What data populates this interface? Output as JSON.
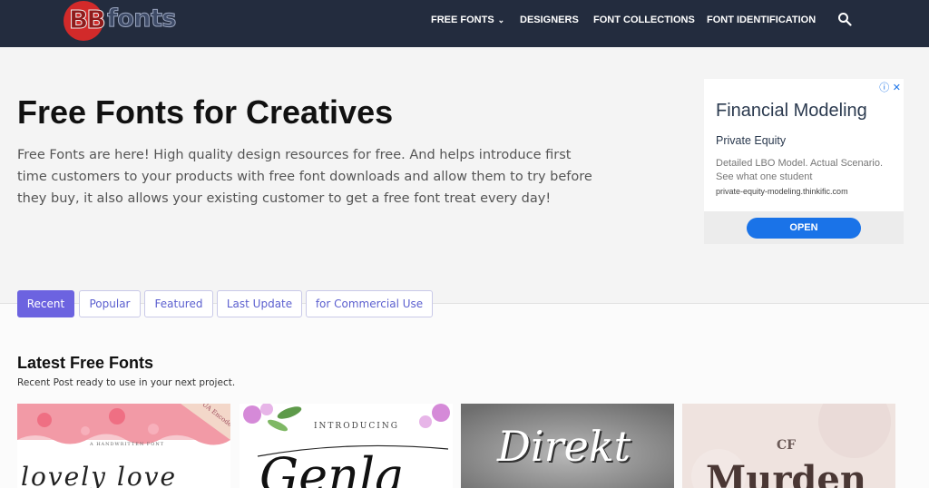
{
  "header": {
    "logo": {
      "bb": "BB",
      "fonts": "fonts"
    },
    "nav": [
      {
        "label": "FREE FONTS",
        "has_dropdown": true
      },
      {
        "label": "DESIGNERS"
      },
      {
        "label": "FONT COLLECTIONS"
      },
      {
        "label": "FONT IDENTIFICATION"
      }
    ],
    "search_icon": "search-icon"
  },
  "hero": {
    "title": "Free Fonts for Creatives",
    "description": "Free Fonts are here! High quality design resources for free. And helps introduce first time customers to your products with free font downloads and allow them to try before they buy, it also allows your existing customer to get a free font treat every day!"
  },
  "ad": {
    "close": "ⓘ ✕",
    "title": "Financial Modeling",
    "subtitle": "Private Equity",
    "body": "Detailed LBO Model. Actual Scenario. See what one student",
    "url": "private-equity-modeling.thinkific.com",
    "button": "OPEN"
  },
  "tabs": [
    {
      "label": "Recent",
      "active": true
    },
    {
      "label": "Popular"
    },
    {
      "label": "Featured"
    },
    {
      "label": "Last Update"
    },
    {
      "label": "for Commercial Use"
    }
  ],
  "section": {
    "title": "Latest Free Fonts",
    "subtitle": "Recent Post ready to use in your next project."
  },
  "cards": [
    {
      "text": "lovely love",
      "tag": "A HANDWRITTEN FONT",
      "corner": "PUA Encoded"
    },
    {
      "text": "Genla",
      "tag": "INTRODUCING"
    },
    {
      "text": "Direkt"
    },
    {
      "text": "Murden",
      "tag": "CF"
    }
  ],
  "colors": {
    "header_bg": "#232c3e",
    "accent": "#6c63e0",
    "ad_button": "#1a73e8"
  }
}
